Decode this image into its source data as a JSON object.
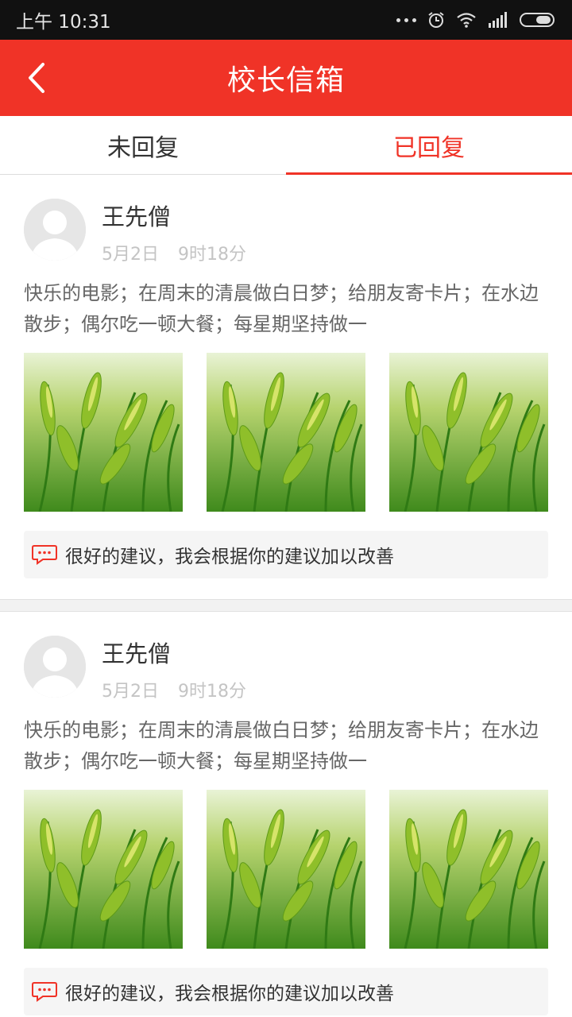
{
  "status_bar": {
    "time": "上午 10:31"
  },
  "header": {
    "title": "校长信箱"
  },
  "tabs": [
    {
      "label": "未回复"
    },
    {
      "label": "已回复"
    }
  ],
  "active_tab": "已回复",
  "accent_color": "#f03327",
  "posts": [
    {
      "name": "王先僧",
      "date": "5月2日",
      "time": "9时18分",
      "content": "快乐的电影；在周末的清晨做白日梦；给朋友寄卡片；在水边散步；偶尔吃一顿大餐；每星期坚持做一",
      "reply": "很好的建议，我会根据你的建议加以改善"
    },
    {
      "name": "王先僧",
      "date": "5月2日",
      "time": "9时18分",
      "content": "快乐的电影；在周末的清晨做白日梦；给朋友寄卡片；在水边散步；偶尔吃一顿大餐；每星期坚持做一",
      "reply": "很好的建议，我会根据你的建议加以改善"
    }
  ]
}
